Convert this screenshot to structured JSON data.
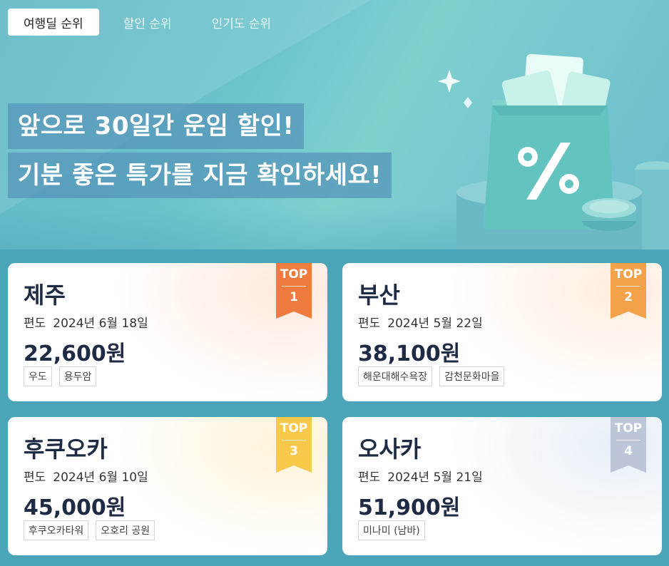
{
  "tabs": [
    {
      "label": "여행딜 순위",
      "active": true
    },
    {
      "label": "할인 순위",
      "active": false
    },
    {
      "label": "인기도 순위",
      "active": false
    }
  ],
  "hero": {
    "line1": "앞으로 30일간 운임 할인!",
    "line2": "기분 좋은 특가를 지금 확인하세요!"
  },
  "cards": [
    {
      "rank_label": "TOP",
      "rank": "1",
      "city": "제주",
      "trip_type": "편도",
      "date": "2024년 6월 18일",
      "price": "22,600원",
      "tags": [
        "우도",
        "용두암"
      ],
      "badge_color": "#f07b3f"
    },
    {
      "rank_label": "TOP",
      "rank": "2",
      "city": "부산",
      "trip_type": "편도",
      "date": "2024년 5월 22일",
      "price": "38,100원",
      "tags": [
        "해운대해수욕장",
        "감천문화마을"
      ],
      "badge_color": "#f4a24a"
    },
    {
      "rank_label": "TOP",
      "rank": "3",
      "city": "후쿠오카",
      "trip_type": "편도",
      "date": "2024년 6월 10일",
      "price": "45,000원",
      "tags": [
        "후쿠오카타워",
        "오호리 공원"
      ],
      "badge_color": "#f8c94b"
    },
    {
      "rank_label": "TOP",
      "rank": "4",
      "city": "오사카",
      "trip_type": "편도",
      "date": "2024년 5월 21일",
      "price": "51,900원",
      "tags": [
        "미나미 (남바)"
      ],
      "badge_color": "#bcc6d8"
    }
  ]
}
